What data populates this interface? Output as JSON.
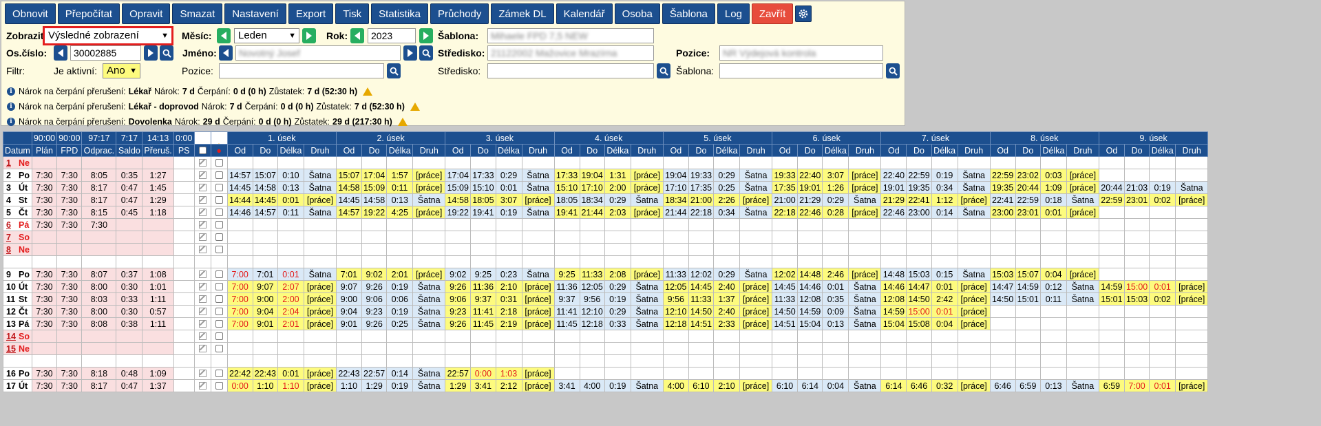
{
  "toolbar": [
    "Obnovit",
    "Přepočítat",
    "Opravit",
    "Smazat",
    "Nastavení",
    "Export",
    "Tisk",
    "Statistika",
    "Průchody",
    "Zámek DL",
    "Kalendář",
    "Osoba",
    "Šablona",
    "Log",
    "Zavřít"
  ],
  "filters": {
    "zobrazit_label": "Zobrazit:",
    "zobrazit_value": "Výsledné zobrazení",
    "mesic_label": "Měsíc:",
    "mesic_value": "Leden",
    "rok_label": "Rok:",
    "rok_value": "2023",
    "sablona_label": "Šablona:",
    "sablona_value": "Mihaele FPD 7,5 NEW",
    "oscislo_label": "Os.číslo:",
    "oscislo_value": "30002885",
    "jmeno_label": "Jméno:",
    "jmeno_value": "Novotný Josef",
    "stredisko_label": "Středisko:",
    "stredisko_value": "21122002 Mažovice Mrazírna",
    "pozice_label": "Pozice:",
    "pozice_value": "NR Výdejová kontrola",
    "filtr_label": "Filtr:",
    "aktivni_label": "Je aktivní:",
    "aktivni_value": "Ano",
    "pozice2_label": "Pozice:",
    "stredisko2_label": "Středisko:",
    "sablona2_label": "Šablona:"
  },
  "info": [
    {
      "prefix": "Nárok na čerpání přerušení:",
      "type": "Lékař",
      "narok_label": "Nárok:",
      "narok": "7 d",
      "cerpani_label": "Čerpání:",
      "cerpani": "0 d (0 h)",
      "zustatek_label": "Zůstatek:",
      "zustatek": "7 d (52:30 h)"
    },
    {
      "prefix": "Nárok na čerpání přerušení:",
      "type": "Lékař - doprovod",
      "narok_label": "Nárok:",
      "narok": "7 d",
      "cerpani_label": "Čerpání:",
      "cerpani": "0 d (0 h)",
      "zustatek_label": "Zůstatek:",
      "zustatek": "7 d (52:30 h)"
    },
    {
      "prefix": "Nárok na čerpání přerušení:",
      "type": "Dovolenka",
      "narok_label": "Nárok:",
      "narok": "29 d",
      "cerpani_label": "Čerpání:",
      "cerpani": "0 d (0 h)",
      "zustatek_label": "Zůstatek:",
      "zustatek": "29 d (217:30 h)"
    }
  ],
  "table": {
    "totals": [
      "90:00",
      "90:00",
      "97:17",
      "7:17",
      "14:13",
      "0:00"
    ],
    "cols": [
      "Datum",
      "Plán",
      "FPD",
      "Odprac.",
      "Saldo",
      "Přeruš.",
      "PS"
    ],
    "seg_titles": [
      "1. úsek",
      "2. úsek",
      "3. úsek",
      "4. úsek",
      "5. úsek",
      "6. úsek",
      "7. úsek",
      "8. úsek",
      "9. úsek"
    ],
    "seg_cols": [
      "Od",
      "Do",
      "Délka",
      "Druh"
    ],
    "rows": [
      {
        "n": "1",
        "d": "Ne",
        "st": "w",
        "plan": "",
        "fpd": "",
        "odp": "",
        "sal": "",
        "pre": "",
        "s": []
      },
      {
        "n": "2",
        "d": "Po",
        "st": "n",
        "plan": "7:30",
        "fpd": "7:30",
        "odp": "8:05",
        "sal": "0:35",
        "pre": "1:27",
        "s": [
          [
            "14:57",
            "15:07",
            "0:10",
            "Šatna"
          ],
          [
            "15:07",
            "17:04",
            "1:57",
            "[práce]"
          ],
          [
            "17:04",
            "17:33",
            "0:29",
            "Šatna"
          ],
          [
            "17:33",
            "19:04",
            "1:31",
            "[práce]"
          ],
          [
            "19:04",
            "19:33",
            "0:29",
            "Šatna"
          ],
          [
            "19:33",
            "22:40",
            "3:07",
            "[práce]"
          ],
          [
            "22:40",
            "22:59",
            "0:19",
            "Šatna"
          ],
          [
            "22:59",
            "23:02",
            "0:03",
            "[práce]"
          ]
        ]
      },
      {
        "n": "3",
        "d": "Út",
        "st": "n",
        "plan": "7:30",
        "fpd": "7:30",
        "odp": "8:17",
        "sal": "0:47",
        "pre": "1:45",
        "s": [
          [
            "14:45",
            "14:58",
            "0:13",
            "Šatna"
          ],
          [
            "14:58",
            "15:09",
            "0:11",
            "[práce]"
          ],
          [
            "15:09",
            "15:10",
            "0:01",
            "Šatna"
          ],
          [
            "15:10",
            "17:10",
            "2:00",
            "[práce]"
          ],
          [
            "17:10",
            "17:35",
            "0:25",
            "Šatna"
          ],
          [
            "17:35",
            "19:01",
            "1:26",
            "[práce]"
          ],
          [
            "19:01",
            "19:35",
            "0:34",
            "Šatna"
          ],
          [
            "19:35",
            "20:44",
            "1:09",
            "[práce]"
          ],
          [
            "20:44",
            "21:03",
            "0:19",
            "Šatna"
          ]
        ]
      },
      {
        "n": "4",
        "d": "St",
        "st": "n",
        "plan": "7:30",
        "fpd": "7:30",
        "odp": "8:17",
        "sal": "0:47",
        "pre": "1:29",
        "s": [
          [
            "14:44",
            "14:45",
            "0:01",
            "[práce]"
          ],
          [
            "14:45",
            "14:58",
            "0:13",
            "Šatna"
          ],
          [
            "14:58",
            "18:05",
            "3:07",
            "[práce]"
          ],
          [
            "18:05",
            "18:34",
            "0:29",
            "Šatna"
          ],
          [
            "18:34",
            "21:00",
            "2:26",
            "[práce]"
          ],
          [
            "21:00",
            "21:29",
            "0:29",
            "Šatna"
          ],
          [
            "21:29",
            "22:41",
            "1:12",
            "[práce]"
          ],
          [
            "22:41",
            "22:59",
            "0:18",
            "Šatna"
          ],
          [
            "22:59",
            "23:01",
            "0:02",
            "[práce]"
          ]
        ]
      },
      {
        "n": "5",
        "d": "Čt",
        "st": "n",
        "plan": "7:30",
        "fpd": "7:30",
        "odp": "8:15",
        "sal": "0:45",
        "pre": "1:18",
        "s": [
          [
            "14:46",
            "14:57",
            "0:11",
            "Šatna"
          ],
          [
            "14:57",
            "19:22",
            "4:25",
            "[práce]"
          ],
          [
            "19:22",
            "19:41",
            "0:19",
            "Šatna"
          ],
          [
            "19:41",
            "21:44",
            "2:03",
            "[práce]"
          ],
          [
            "21:44",
            "22:18",
            "0:34",
            "Šatna"
          ],
          [
            "22:18",
            "22:46",
            "0:28",
            "[práce]"
          ],
          [
            "22:46",
            "23:00",
            "0:14",
            "Šatna"
          ],
          [
            "23:00",
            "23:01",
            "0:01",
            "[práce]"
          ]
        ]
      },
      {
        "n": "6",
        "d": "Pá",
        "st": "h",
        "plan": "7:30",
        "fpd": "7:30",
        "odp": "7:30",
        "sal": "",
        "pre": "",
        "s": []
      },
      {
        "n": "7",
        "d": "So",
        "st": "w",
        "plan": "",
        "fpd": "",
        "odp": "",
        "sal": "",
        "pre": "",
        "s": []
      },
      {
        "n": "8",
        "d": "Ne",
        "st": "w",
        "plan": "",
        "fpd": "",
        "odp": "",
        "sal": "",
        "pre": "",
        "s": []
      },
      {
        "n": "",
        "d": "",
        "st": "e",
        "plan": "",
        "fpd": "",
        "odp": "",
        "sal": "",
        "pre": "",
        "s": []
      },
      {
        "n": "9",
        "d": "Po",
        "st": "n",
        "plan": "7:30",
        "fpd": "7:30",
        "odp": "8:07",
        "sal": "0:37",
        "pre": "1:08",
        "s": [
          [
            "7:00",
            "7:01",
            "0:01",
            "Šatna",
            "r"
          ],
          [
            "7:01",
            "9:02",
            "2:01",
            "[práce]"
          ],
          [
            "9:02",
            "9:25",
            "0:23",
            "Šatna"
          ],
          [
            "9:25",
            "11:33",
            "2:08",
            "[práce]"
          ],
          [
            "11:33",
            "12:02",
            "0:29",
            "Šatna"
          ],
          [
            "12:02",
            "14:48",
            "2:46",
            "[práce]"
          ],
          [
            "14:48",
            "15:03",
            "0:15",
            "Šatna"
          ],
          [
            "15:03",
            "15:07",
            "0:04",
            "[práce]"
          ]
        ]
      },
      {
        "n": "10",
        "d": "Út",
        "st": "n",
        "plan": "7:30",
        "fpd": "7:30",
        "odp": "8:00",
        "sal": "0:30",
        "pre": "1:01",
        "s": [
          [
            "7:00",
            "9:07",
            "2:07",
            "[práce]",
            "r"
          ],
          [
            "9:07",
            "9:26",
            "0:19",
            "Šatna"
          ],
          [
            "9:26",
            "11:36",
            "2:10",
            "[práce]"
          ],
          [
            "11:36",
            "12:05",
            "0:29",
            "Šatna"
          ],
          [
            "12:05",
            "14:45",
            "2:40",
            "[práce]"
          ],
          [
            "14:45",
            "14:46",
            "0:01",
            "Šatna"
          ],
          [
            "14:46",
            "14:47",
            "0:01",
            "[práce]"
          ],
          [
            "14:47",
            "14:59",
            "0:12",
            "Šatna"
          ],
          [
            "14:59",
            "15:00",
            "0:01",
            "[práce]",
            "r2"
          ]
        ]
      },
      {
        "n": "11",
        "d": "St",
        "st": "n",
        "plan": "7:30",
        "fpd": "7:30",
        "odp": "8:03",
        "sal": "0:33",
        "pre": "1:11",
        "s": [
          [
            "7:00",
            "9:00",
            "2:00",
            "[práce]",
            "r"
          ],
          [
            "9:00",
            "9:06",
            "0:06",
            "Šatna"
          ],
          [
            "9:06",
            "9:37",
            "0:31",
            "[práce]"
          ],
          [
            "9:37",
            "9:56",
            "0:19",
            "Šatna"
          ],
          [
            "9:56",
            "11:33",
            "1:37",
            "[práce]"
          ],
          [
            "11:33",
            "12:08",
            "0:35",
            "Šatna"
          ],
          [
            "12:08",
            "14:50",
            "2:42",
            "[práce]"
          ],
          [
            "14:50",
            "15:01",
            "0:11",
            "Šatna"
          ],
          [
            "15:01",
            "15:03",
            "0:02",
            "[práce]"
          ]
        ]
      },
      {
        "n": "12",
        "d": "Čt",
        "st": "n",
        "plan": "7:30",
        "fpd": "7:30",
        "odp": "8:00",
        "sal": "0:30",
        "pre": "0:57",
        "s": [
          [
            "7:00",
            "9:04",
            "2:04",
            "[práce]",
            "r"
          ],
          [
            "9:04",
            "9:23",
            "0:19",
            "Šatna"
          ],
          [
            "9:23",
            "11:41",
            "2:18",
            "[práce]"
          ],
          [
            "11:41",
            "12:10",
            "0:29",
            "Šatna"
          ],
          [
            "12:10",
            "14:50",
            "2:40",
            "[práce]"
          ],
          [
            "14:50",
            "14:59",
            "0:09",
            "Šatna"
          ],
          [
            "14:59",
            "15:00",
            "0:01",
            "[práce]",
            "r2"
          ]
        ]
      },
      {
        "n": "13",
        "d": "Pá",
        "st": "n",
        "plan": "7:30",
        "fpd": "7:30",
        "odp": "8:08",
        "sal": "0:38",
        "pre": "1:11",
        "s": [
          [
            "7:00",
            "9:01",
            "2:01",
            "[práce]",
            "r"
          ],
          [
            "9:01",
            "9:26",
            "0:25",
            "Šatna"
          ],
          [
            "9:26",
            "11:45",
            "2:19",
            "[práce]"
          ],
          [
            "11:45",
            "12:18",
            "0:33",
            "Šatna"
          ],
          [
            "12:18",
            "14:51",
            "2:33",
            "[práce]"
          ],
          [
            "14:51",
            "15:04",
            "0:13",
            "Šatna"
          ],
          [
            "15:04",
            "15:08",
            "0:04",
            "[práce]"
          ]
        ]
      },
      {
        "n": "14",
        "d": "So",
        "st": "w",
        "plan": "",
        "fpd": "",
        "odp": "",
        "sal": "",
        "pre": "",
        "s": []
      },
      {
        "n": "15",
        "d": "Ne",
        "st": "w",
        "plan": "",
        "fpd": "",
        "odp": "",
        "sal": "",
        "pre": "",
        "s": []
      },
      {
        "n": "",
        "d": "",
        "st": "e",
        "plan": "",
        "fpd": "",
        "odp": "",
        "sal": "",
        "pre": "",
        "s": []
      },
      {
        "n": "16",
        "d": "Po",
        "st": "n",
        "plan": "7:30",
        "fpd": "7:30",
        "odp": "8:18",
        "sal": "0:48",
        "pre": "1:09",
        "s": [
          [
            "22:42",
            "22:43",
            "0:01",
            "[práce]"
          ],
          [
            "22:43",
            "22:57",
            "0:14",
            "Šatna"
          ],
          [
            "22:57",
            "0:00",
            "1:03",
            "[práce]",
            "r2"
          ]
        ]
      },
      {
        "n": "17",
        "d": "Út",
        "st": "n",
        "plan": "7:30",
        "fpd": "7:30",
        "odp": "8:17",
        "sal": "0:47",
        "pre": "1:37",
        "s": [
          [
            "0:00",
            "1:10",
            "1:10",
            "[práce]",
            "r"
          ],
          [
            "1:10",
            "1:29",
            "0:19",
            "Šatna"
          ],
          [
            "1:29",
            "3:41",
            "2:12",
            "[práce]"
          ],
          [
            "3:41",
            "4:00",
            "0:19",
            "Šatna"
          ],
          [
            "4:00",
            "6:10",
            "2:10",
            "[práce]"
          ],
          [
            "6:10",
            "6:14",
            "0:04",
            "Šatna"
          ],
          [
            "6:14",
            "6:46",
            "0:32",
            "[práce]"
          ],
          [
            "6:46",
            "6:59",
            "0:13",
            "Šatna"
          ],
          [
            "6:59",
            "7:00",
            "0:01",
            "[práce]",
            "r2"
          ]
        ]
      }
    ]
  }
}
